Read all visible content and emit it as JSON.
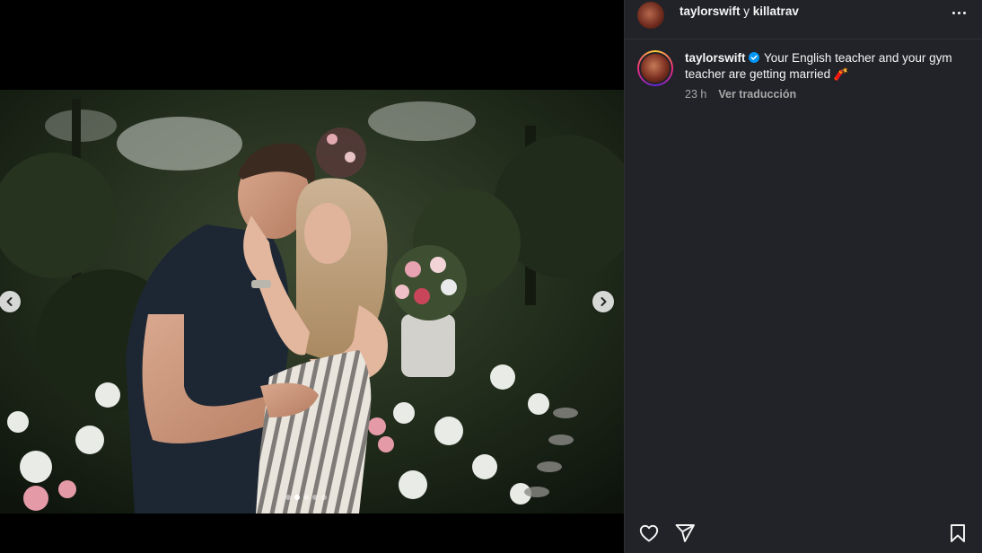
{
  "post": {
    "header": {
      "user_primary": "taylorswift",
      "separator": "y",
      "user_collab": "killatrav"
    },
    "caption": {
      "username": "taylorswift",
      "verified": true,
      "text": "Your English teacher and your gym teacher are getting married",
      "emoji": "🧨"
    },
    "meta": {
      "time": "23 h",
      "translate_label": "Ver traducción"
    },
    "carousel": {
      "total_slides": 5,
      "active_slide": 2
    }
  },
  "icons": {
    "like": "heart-icon",
    "share": "send-icon",
    "save": "bookmark-icon",
    "more": "more-horizontal-icon",
    "prev": "chevron-left-icon",
    "next": "chevron-right-icon",
    "verified": "verified-badge-icon"
  },
  "colors": {
    "panel_bg": "#212328",
    "verified_blue": "#0095f6",
    "muted_text": "#a8a8a8"
  }
}
